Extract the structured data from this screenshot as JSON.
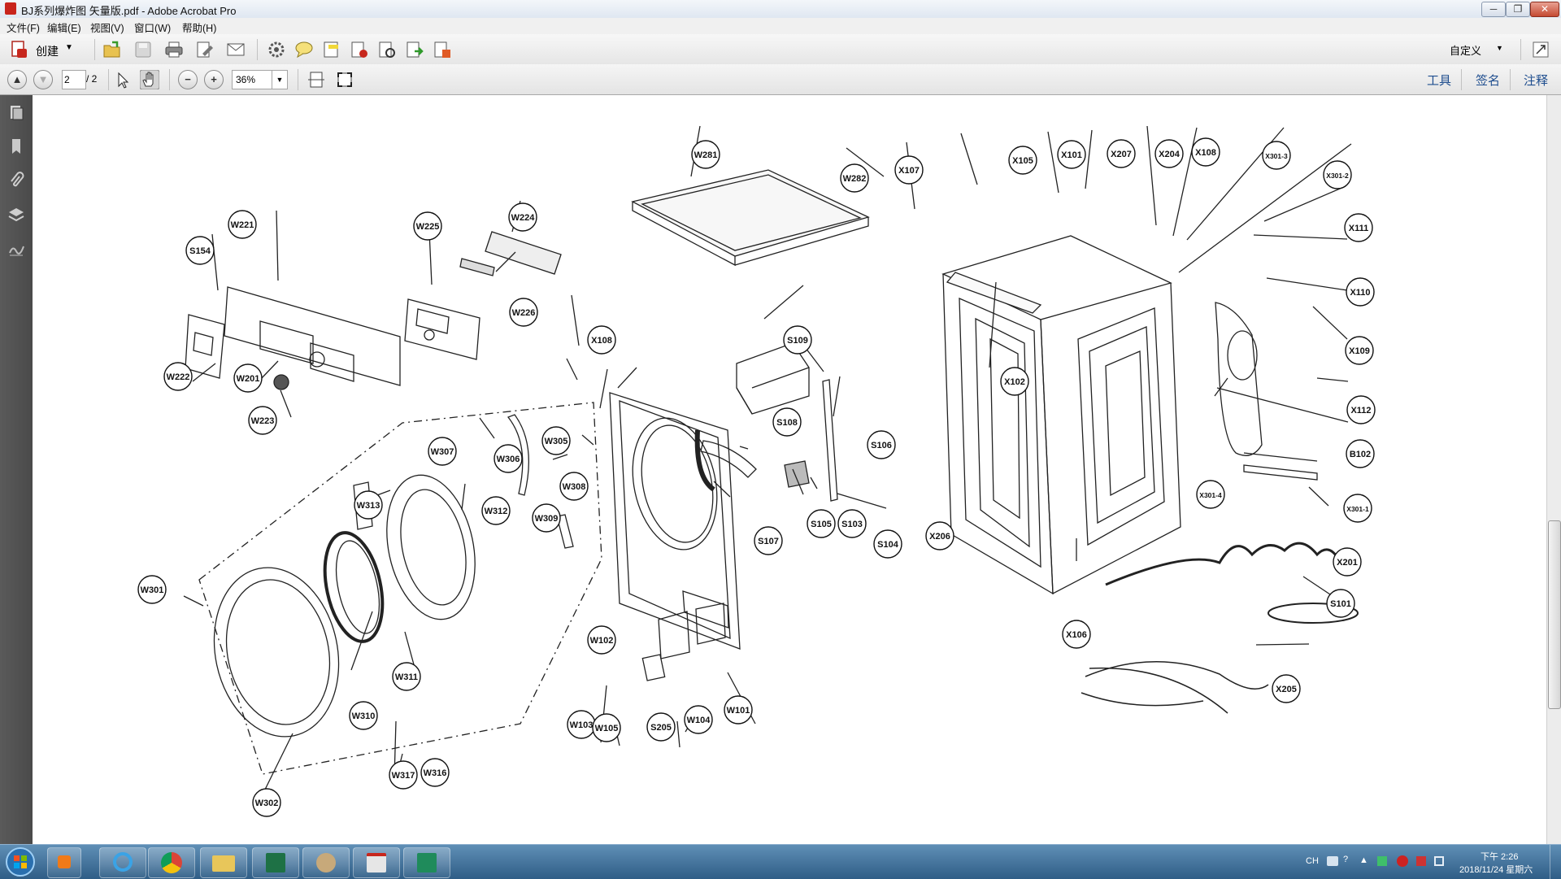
{
  "window": {
    "title": "BJ系列爆炸图 矢量版.pdf - Adobe Acrobat Pro",
    "minimize": "─",
    "restore": "❐",
    "close": "✕"
  },
  "menu": [
    "文件(F)",
    "编辑(E)",
    "视图(V)",
    "窗口(W)",
    "帮助(H)"
  ],
  "toolbar": {
    "create_label": "创建",
    "customize_label": "自定义",
    "icons": [
      "open-folder-icon",
      "save-icon",
      "print-icon",
      "edit-icon",
      "email-icon",
      "gear-icon",
      "comment-icon",
      "highlight-icon",
      "sign-icon",
      "secure-icon",
      "review-icon",
      "export-icon"
    ]
  },
  "nav": {
    "page_value": "2",
    "page_total": "/ 2",
    "zoom_value": "36%",
    "tools_label": "工具",
    "sign_label": "签名",
    "comment_label": "注释"
  },
  "diagram": {
    "labels": [
      "W281",
      "W282",
      "X107",
      "X105",
      "X101",
      "X207",
      "X204",
      "X108",
      "X301-3",
      "X301-2",
      "X111",
      "X110",
      "X109",
      "X112",
      "B102",
      "X301-1",
      "X301-4",
      "X201",
      "S101",
      "X106",
      "X205",
      "W221",
      "W225",
      "W224",
      "S154",
      "W226",
      "W222",
      "W201",
      "W223",
      "X108",
      "S109",
      "S108",
      "S106",
      "X102",
      "W307",
      "W306",
      "W305",
      "W313",
      "W312",
      "W308",
      "W309",
      "S107",
      "S105",
      "S103",
      "S104",
      "X206",
      "W301",
      "W102",
      "W311",
      "W310",
      "W302",
      "W317",
      "W316",
      "W103",
      "W105",
      "S205",
      "W104",
      "W101"
    ]
  },
  "taskbar": {
    "lang": "CH",
    "time": "下午 2:26",
    "date": "2018/11/24 星期六"
  }
}
